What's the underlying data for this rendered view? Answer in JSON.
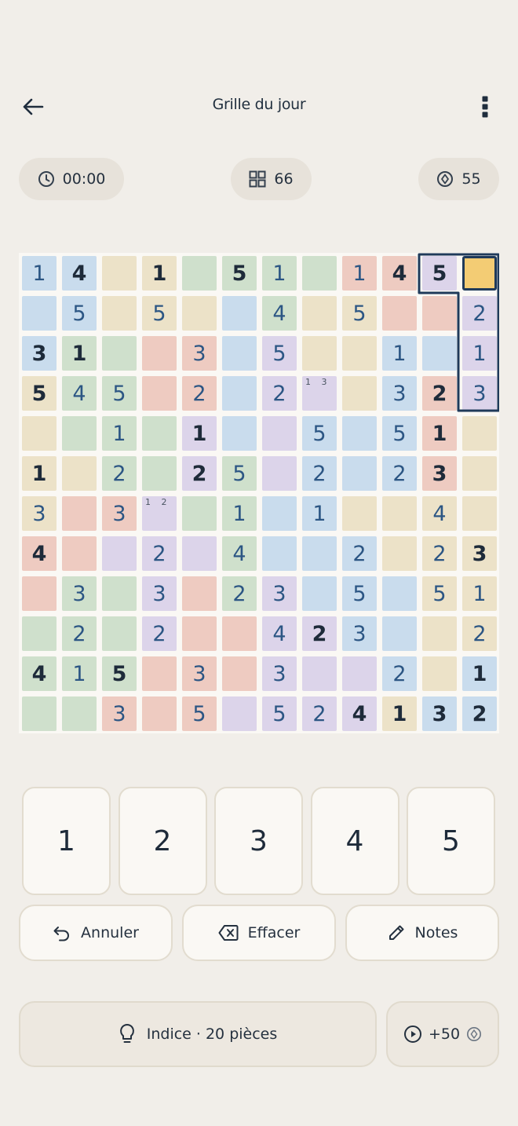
{
  "header": {
    "title": "Grille du jour"
  },
  "stats": {
    "timer": "00:00",
    "cells_remaining": "66",
    "coins": "55"
  },
  "grid": {
    "rows": [
      [
        {
          "v": "1",
          "t": "u",
          "c": "blue"
        },
        {
          "v": "4",
          "t": "g",
          "c": "blue"
        },
        {
          "v": "",
          "c": "cream"
        },
        {
          "v": "1",
          "t": "g",
          "c": "cream"
        },
        {
          "v": "",
          "c": "green"
        },
        {
          "v": "5",
          "t": "g",
          "c": "green"
        },
        {
          "v": "1",
          "t": "u",
          "c": "green"
        },
        {
          "v": "",
          "c": "green"
        },
        {
          "v": "1",
          "t": "u",
          "c": "pink"
        },
        {
          "v": "4",
          "t": "g",
          "c": "pink"
        },
        {
          "v": "5",
          "t": "g",
          "c": "lav"
        },
        {
          "v": "",
          "c": "gold",
          "selected": true
        }
      ],
      [
        {
          "v": "",
          "c": "blue"
        },
        {
          "v": "5",
          "t": "u",
          "c": "blue"
        },
        {
          "v": "",
          "c": "cream"
        },
        {
          "v": "5",
          "t": "u",
          "c": "cream"
        },
        {
          "v": "",
          "c": "cream"
        },
        {
          "v": "",
          "c": "blue"
        },
        {
          "v": "4",
          "t": "u",
          "c": "green"
        },
        {
          "v": "",
          "c": "cream"
        },
        {
          "v": "5",
          "t": "u",
          "c": "cream"
        },
        {
          "v": "",
          "c": "pink"
        },
        {
          "v": "",
          "c": "pink"
        },
        {
          "v": "2",
          "t": "u",
          "c": "lav"
        }
      ],
      [
        {
          "v": "3",
          "t": "g",
          "c": "blue"
        },
        {
          "v": "1",
          "t": "g",
          "c": "green"
        },
        {
          "v": "",
          "c": "green"
        },
        {
          "v": "",
          "c": "pink"
        },
        {
          "v": "3",
          "t": "u",
          "c": "pink"
        },
        {
          "v": "",
          "c": "blue"
        },
        {
          "v": "5",
          "t": "u",
          "c": "lav"
        },
        {
          "v": "",
          "c": "cream"
        },
        {
          "v": "",
          "c": "cream"
        },
        {
          "v": "1",
          "t": "u",
          "c": "blue"
        },
        {
          "v": "",
          "c": "blue"
        },
        {
          "v": "1",
          "t": "u",
          "c": "lav"
        }
      ],
      [
        {
          "v": "5",
          "t": "g",
          "c": "cream"
        },
        {
          "v": "4",
          "t": "u",
          "c": "green"
        },
        {
          "v": "5",
          "t": "u",
          "c": "green"
        },
        {
          "v": "",
          "c": "pink"
        },
        {
          "v": "2",
          "t": "u",
          "c": "pink"
        },
        {
          "v": "",
          "c": "blue"
        },
        {
          "v": "2",
          "t": "u",
          "c": "lav"
        },
        {
          "v": "",
          "c": "lav",
          "notes": "1 3"
        },
        {
          "v": "",
          "c": "cream"
        },
        {
          "v": "3",
          "t": "u",
          "c": "blue"
        },
        {
          "v": "2",
          "t": "g",
          "c": "pink"
        },
        {
          "v": "3",
          "t": "u",
          "c": "lav"
        }
      ],
      [
        {
          "v": "",
          "c": "cream"
        },
        {
          "v": "",
          "c": "green"
        },
        {
          "v": "1",
          "t": "u",
          "c": "green"
        },
        {
          "v": "",
          "c": "green"
        },
        {
          "v": "1",
          "t": "g",
          "c": "lav"
        },
        {
          "v": "",
          "c": "blue"
        },
        {
          "v": "",
          "c": "lav"
        },
        {
          "v": "5",
          "t": "u",
          "c": "blue"
        },
        {
          "v": "",
          "c": "blue"
        },
        {
          "v": "5",
          "t": "u",
          "c": "blue"
        },
        {
          "v": "1",
          "t": "g",
          "c": "pink"
        },
        {
          "v": "",
          "c": "cream"
        }
      ],
      [
        {
          "v": "1",
          "t": "g",
          "c": "cream"
        },
        {
          "v": "",
          "c": "cream"
        },
        {
          "v": "2",
          "t": "u",
          "c": "green"
        },
        {
          "v": "",
          "c": "green"
        },
        {
          "v": "2",
          "t": "g",
          "c": "lav"
        },
        {
          "v": "5",
          "t": "u",
          "c": "green"
        },
        {
          "v": "",
          "c": "lav"
        },
        {
          "v": "2",
          "t": "u",
          "c": "blue"
        },
        {
          "v": "",
          "c": "blue"
        },
        {
          "v": "2",
          "t": "u",
          "c": "blue"
        },
        {
          "v": "3",
          "t": "g",
          "c": "pink"
        },
        {
          "v": "",
          "c": "cream"
        }
      ],
      [
        {
          "v": "3",
          "t": "u",
          "c": "cream"
        },
        {
          "v": "",
          "c": "pink"
        },
        {
          "v": "3",
          "t": "u",
          "c": "pink"
        },
        {
          "v": "",
          "c": "lav",
          "notes": "1 2"
        },
        {
          "v": "",
          "c": "green"
        },
        {
          "v": "1",
          "t": "u",
          "c": "green"
        },
        {
          "v": "",
          "c": "blue"
        },
        {
          "v": "1",
          "t": "u",
          "c": "blue"
        },
        {
          "v": "",
          "c": "cream"
        },
        {
          "v": "",
          "c": "cream"
        },
        {
          "v": "4",
          "t": "u",
          "c": "cream"
        },
        {
          "v": "",
          "c": "cream"
        }
      ],
      [
        {
          "v": "4",
          "t": "g",
          "c": "pink"
        },
        {
          "v": "",
          "c": "pink"
        },
        {
          "v": "",
          "c": "lav"
        },
        {
          "v": "2",
          "t": "u",
          "c": "lav"
        },
        {
          "v": "",
          "c": "lav"
        },
        {
          "v": "4",
          "t": "u",
          "c": "green"
        },
        {
          "v": "",
          "c": "blue"
        },
        {
          "v": "",
          "c": "blue"
        },
        {
          "v": "2",
          "t": "u",
          "c": "blue"
        },
        {
          "v": "",
          "c": "cream"
        },
        {
          "v": "2",
          "t": "u",
          "c": "cream"
        },
        {
          "v": "3",
          "t": "g",
          "c": "cream"
        }
      ],
      [
        {
          "v": "",
          "c": "pink"
        },
        {
          "v": "3",
          "t": "u",
          "c": "green"
        },
        {
          "v": "",
          "c": "green"
        },
        {
          "v": "3",
          "t": "u",
          "c": "lav"
        },
        {
          "v": "",
          "c": "pink"
        },
        {
          "v": "2",
          "t": "u",
          "c": "green"
        },
        {
          "v": "3",
          "t": "u",
          "c": "lav"
        },
        {
          "v": "",
          "c": "blue"
        },
        {
          "v": "5",
          "t": "u",
          "c": "blue"
        },
        {
          "v": "",
          "c": "blue"
        },
        {
          "v": "5",
          "t": "u",
          "c": "cream"
        },
        {
          "v": "1",
          "t": "u",
          "c": "cream"
        }
      ],
      [
        {
          "v": "",
          "c": "green"
        },
        {
          "v": "2",
          "t": "u",
          "c": "green"
        },
        {
          "v": "",
          "c": "green"
        },
        {
          "v": "2",
          "t": "u",
          "c": "lav"
        },
        {
          "v": "",
          "c": "pink"
        },
        {
          "v": "",
          "c": "pink"
        },
        {
          "v": "4",
          "t": "u",
          "c": "lav"
        },
        {
          "v": "2",
          "t": "g",
          "c": "lav"
        },
        {
          "v": "3",
          "t": "u",
          "c": "blue"
        },
        {
          "v": "",
          "c": "blue"
        },
        {
          "v": "",
          "c": "cream"
        },
        {
          "v": "2",
          "t": "u",
          "c": "cream"
        }
      ],
      [
        {
          "v": "4",
          "t": "g",
          "c": "green"
        },
        {
          "v": "1",
          "t": "u",
          "c": "green"
        },
        {
          "v": "5",
          "t": "g",
          "c": "green"
        },
        {
          "v": "",
          "c": "pink"
        },
        {
          "v": "3",
          "t": "u",
          "c": "pink"
        },
        {
          "v": "",
          "c": "pink"
        },
        {
          "v": "3",
          "t": "u",
          "c": "lav"
        },
        {
          "v": "",
          "c": "lav"
        },
        {
          "v": "",
          "c": "lav"
        },
        {
          "v": "2",
          "t": "u",
          "c": "blue"
        },
        {
          "v": "",
          "c": "cream"
        },
        {
          "v": "1",
          "t": "g",
          "c": "blue"
        }
      ],
      [
        {
          "v": "",
          "c": "green"
        },
        {
          "v": "",
          "c": "green"
        },
        {
          "v": "3",
          "t": "u",
          "c": "pink"
        },
        {
          "v": "",
          "c": "pink"
        },
        {
          "v": "5",
          "t": "u",
          "c": "pink"
        },
        {
          "v": "",
          "c": "lav"
        },
        {
          "v": "5",
          "t": "u",
          "c": "lav"
        },
        {
          "v": "2",
          "t": "u",
          "c": "lav"
        },
        {
          "v": "4",
          "t": "g",
          "c": "lav"
        },
        {
          "v": "1",
          "t": "g",
          "c": "cream"
        },
        {
          "v": "3",
          "t": "g",
          "c": "blue"
        },
        {
          "v": "2",
          "t": "g",
          "c": "blue"
        }
      ]
    ]
  },
  "number_pad": [
    "1",
    "2",
    "3",
    "4",
    "5"
  ],
  "actions": {
    "undo": "Annuler",
    "erase": "Effacer",
    "notes": "Notes"
  },
  "hint": {
    "label": "Indice · 20 pièces"
  },
  "video_reward": {
    "label": "+50"
  },
  "colors": {
    "background": "#f1eee9",
    "accent_dark": "#1f3a5a",
    "selected_cell": "#f3cc74",
    "region_blue": "#c9dced",
    "region_green": "#cfe0cc",
    "region_cream": "#ece2c8",
    "region_pink": "#eecbc1",
    "region_lavender": "#dcd4ea"
  }
}
